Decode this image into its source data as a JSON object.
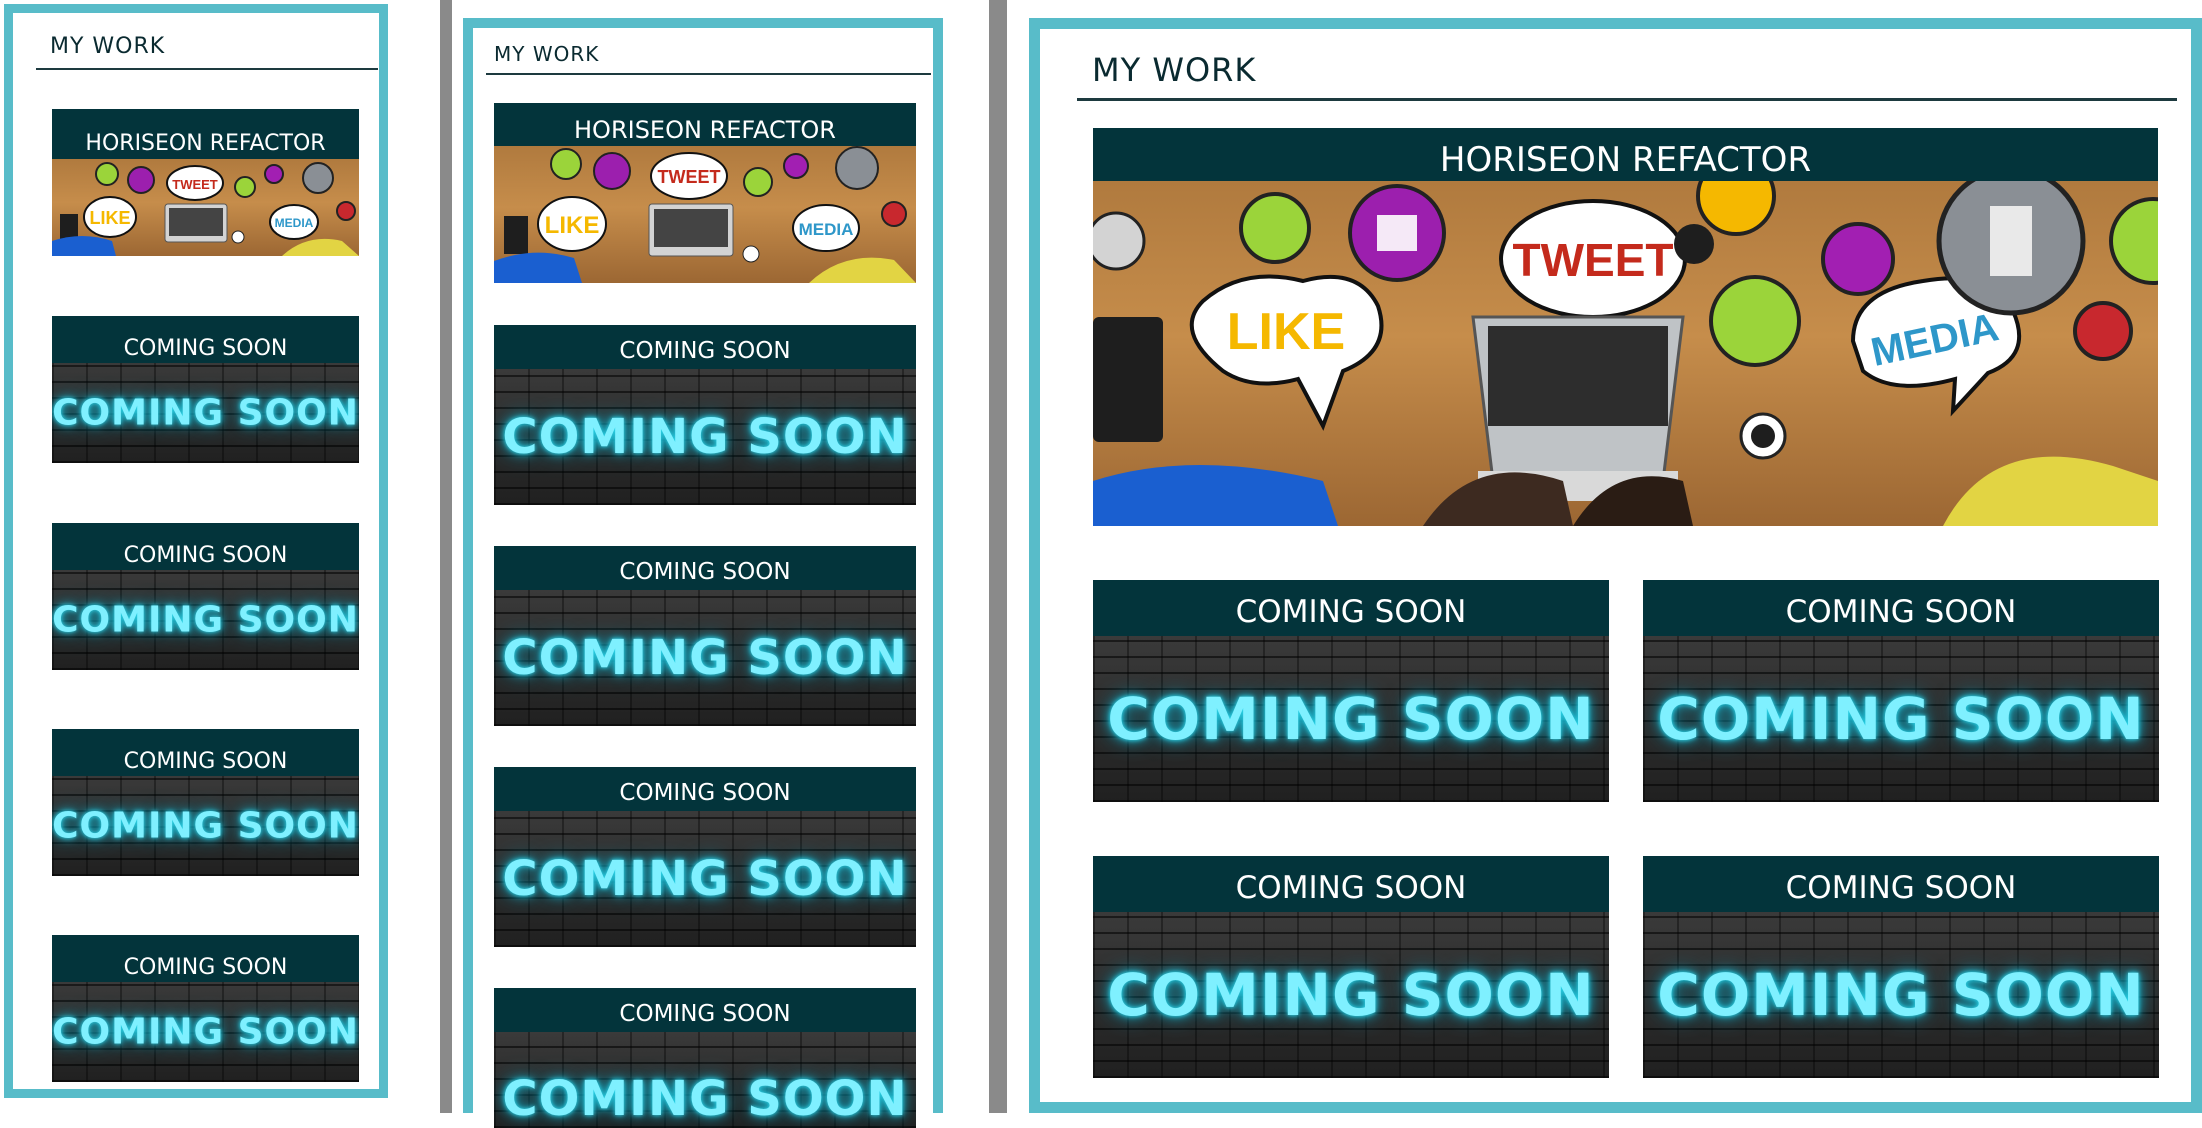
{
  "section": {
    "heading": "MY WORK"
  },
  "featured": {
    "title": "HORISEON REFACTOR",
    "bubbles": {
      "like": "LIKE",
      "tweet": "TWEET",
      "media": "MEDIA"
    }
  },
  "placeholder": {
    "title": "COMING SOON",
    "image_text": "COMING SOON"
  },
  "colors": {
    "panel_border": "#58bcc9",
    "card_header": "#03343b",
    "neon": "#7ff0ff"
  }
}
